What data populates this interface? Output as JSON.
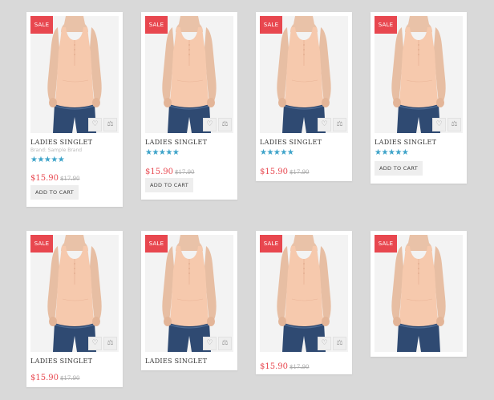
{
  "colors": {
    "page_background": "#d9d9d9",
    "card": "#ffffff",
    "sale_badge": "#e8474f",
    "price": "#e8474f",
    "stars": "#3ea3c9"
  },
  "icons": {
    "wishlist": "heart-icon",
    "compare": "scale-icon"
  },
  "products": [
    {
      "sale_label": "SALE",
      "title": "LADIES SINGLET",
      "brand": "Brand: Sample Brand",
      "stars": "★★★★★",
      "rating": 5,
      "price": "$15.90",
      "old_price": "$17.90",
      "cart_label": "ADD TO CART"
    },
    {
      "sale_label": "SALE",
      "title": "LADIES SINGLET",
      "stars": "★★★★★",
      "rating": 5,
      "price": "$15.90",
      "old_price": "$17.90",
      "cart_label": "ADD TO CART"
    },
    {
      "sale_label": "SALE",
      "title": "LADIES SINGLET",
      "stars": "★★★★★",
      "rating": 5,
      "price": "$15.90",
      "old_price": "$17.90"
    },
    {
      "sale_label": "SALE",
      "title": "LADIES SINGLET",
      "stars": "★★★★★",
      "rating": 5,
      "cart_label": "ADD TO CART"
    },
    {
      "sale_label": "SALE",
      "title": "LADIES SINGLET",
      "price": "$15.90",
      "old_price": "$17.90"
    },
    {
      "sale_label": "SALE",
      "title": "LADIES SINGLET"
    },
    {
      "sale_label": "SALE",
      "price": "$15.90",
      "old_price": "$17.90"
    },
    {
      "sale_label": "SALE"
    }
  ]
}
